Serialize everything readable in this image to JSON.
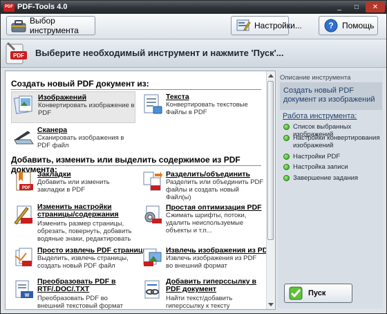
{
  "window": {
    "title": "PDF-Tools 4.0",
    "app_icon_text": "PDF"
  },
  "titlebar_buttons": {
    "minimize": "_",
    "maximize": "□",
    "close": "✕"
  },
  "toolbar": {
    "choose_tool_label": "Выбор инструмента",
    "settings_label": "Настройки...",
    "help_label": "Помощь"
  },
  "banner": {
    "text": "Выберите необходимый инструмент и нажмите 'Пуск'..."
  },
  "content": {
    "section1_title": "Создать новый PDF документ из:",
    "section2_title": "Добавить, изменить или выделить содержимое из PDF документа:",
    "items": [
      {
        "title": "Изображений",
        "desc": "Конвертировать изображение в PDF",
        "icon": "images-icon"
      },
      {
        "title": "Текста",
        "desc": "Конвертировать текстовые Файлы в PDF",
        "icon": "text-icon"
      },
      {
        "title": "Сканера",
        "desc": "Сканировать изображения в PDF файл",
        "icon": "scanner-icon"
      },
      {
        "title": "Закладки",
        "desc": "Добавить или изменить закладки в PDF",
        "icon": "bookmarks-icon"
      },
      {
        "title": "Разделить/объединить",
        "desc": "Разделить или объединить PDF файлы и создать новый Файл(ы)",
        "icon": "split-merge-icon"
      },
      {
        "title": "Изменить настройки страницы/содержания",
        "desc": "Изменить размер страницы, обрезать, повернуть, добавить водяные знаки, редактировать",
        "icon": "page-settings-icon"
      },
      {
        "title": "Простая оптимизация PDF",
        "desc": "Сжимать шрифты, потоки, удалить неиспользуемые объекты и т.п...",
        "icon": "optimize-icon"
      },
      {
        "title": "Просто извлечь PDF страницы",
        "desc": "Выделить, извлечь страницы, создать новый PDF файл",
        "icon": "extract-pages-icon"
      },
      {
        "title": "Извлечь изображения из PDF",
        "desc": "Извлечь изображения из PDF во внешний формат",
        "icon": "extract-images-icon"
      },
      {
        "title": "Преобразовать PDF в RTF/.DOC/.TXT",
        "desc": "Преобразовать PDF во внешний текстовый формат (RTF/DOC,",
        "icon": "convert-icon"
      },
      {
        "title": "Добавить гиперссылку в PDF документ",
        "desc": "Найти текст/добавить гиперссылку к тексту",
        "icon": "hyperlink-icon"
      }
    ]
  },
  "sidebar": {
    "header": "Описание инструмента",
    "task": "Создать новый PDF документ из изображений",
    "workflow_title": "Работа инструмента:",
    "steps": [
      "Список выбранных изображений",
      "Настройки конвертирования изображений",
      "Настройки PDF",
      "Настройка записи",
      "Завершение задания"
    ]
  },
  "start_button": {
    "label": "Пуск"
  },
  "colors": {
    "accent": "#1f3f6b",
    "title_bar": "#2d3338",
    "pdf_red": "#c81e1e",
    "step_green": "#2c9a18"
  }
}
